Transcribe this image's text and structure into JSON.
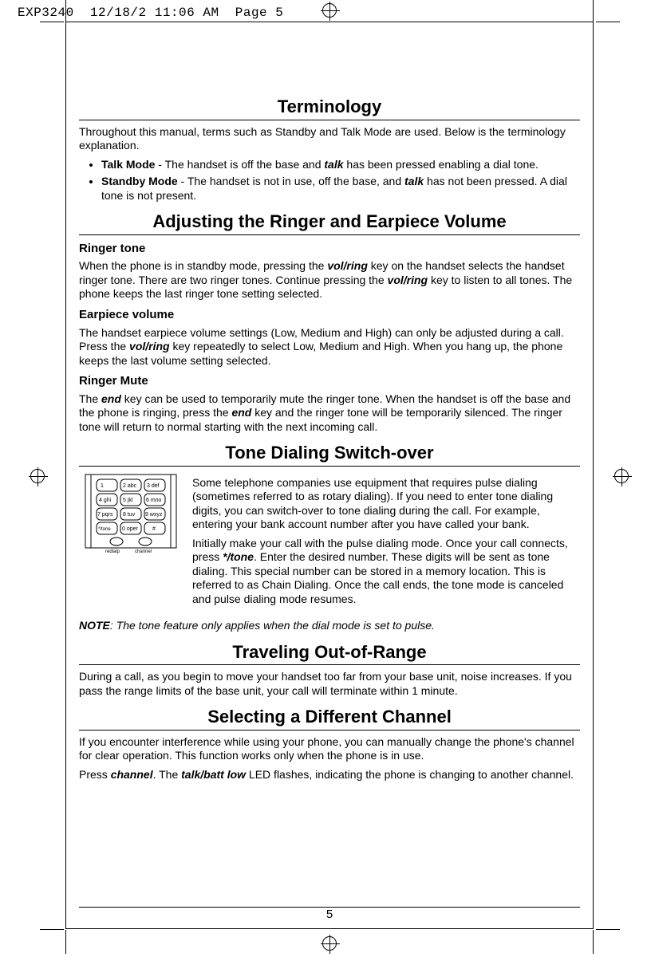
{
  "print_header": "EXP3240  12/18/2 11:06 AM  Page 5",
  "page_number": "5",
  "sec1": {
    "title": "Terminology",
    "intro": "Throughout this manual, terms such as Standby and Talk Mode are used. Below is the terminology explanation.",
    "items": [
      {
        "label": "Talk Mode",
        "text_pre": " - The handset is off the base and ",
        "key": "talk",
        "text_post": " has been pressed enabling a dial tone."
      },
      {
        "label": "Standby Mode",
        "text_pre": " - The handset is not in use, off the base, and ",
        "key": "talk",
        "text_post": " has not been pressed. A dial tone is not present."
      }
    ]
  },
  "sec2": {
    "title": "Adjusting the Ringer and Earpiece Volume",
    "ringer_tone_h": "Ringer tone",
    "ringer_tone_p1_a": "When the phone is in standby mode, pressing the ",
    "ringer_tone_key": "vol/ring",
    "ringer_tone_p1_b": " key on the handset selects the handset ringer tone. There are two ringer tones. Continue pressing the ",
    "ringer_tone_p1_c": " key to listen to all tones. The phone keeps the last ringer tone setting selected.",
    "earpiece_h": "Earpiece volume",
    "earpiece_p_a": "The handset earpiece volume settings (Low, Medium and High) can only be adjusted during a call. Press the ",
    "earpiece_p_b": " key repeatedly to select Low, Medium and High. When you hang up, the phone keeps the last volume setting selected.",
    "mute_h": "Ringer Mute",
    "mute_p_a": "The ",
    "mute_key": "end",
    "mute_p_b": " key can be used to temporarily mute the ringer tone. When the handset is off the base and the phone is ringing, press the ",
    "mute_p_c": " key and the ringer tone will be temporarily silenced. The ringer tone will return to normal starting with the next incoming call."
  },
  "sec3": {
    "title": "Tone Dialing Switch-over",
    "p1": "Some telephone companies use equipment that requires pulse dialing (sometimes referred to as rotary dialing). If you need to enter tone dialing digits, you can switch-over to tone dialing during the call. For example, entering your bank account number after you have called your bank.",
    "p2_a": "Initially make your call with the pulse dialing mode. Once your call connects, press ",
    "p2_key": "*/tone",
    "p2_b": ". Enter the desired number. These digits will be sent as tone dialing. This special number can be stored in a memory location. This is referred to as Chain Dialing. Once the call ends, the tone mode is canceled and pulse dialing mode resumes.",
    "note_label": "NOTE",
    "note_text": ": The tone feature only applies when the dial mode is set to pulse.",
    "keypad_labels": {
      "r1": [
        "1",
        "2 abc",
        "3 def"
      ],
      "r2": [
        "4 ghi",
        "5 jkl",
        "6 mno"
      ],
      "r3": [
        "7 pqrs",
        "8 tuv",
        "9 wxyz"
      ],
      "r4": [
        "*/tone",
        "0 oper",
        "#"
      ],
      "r5": [
        "redialp",
        "channel"
      ]
    }
  },
  "sec4": {
    "title": "Traveling Out-of-Range",
    "body": "During a call, as you begin to move your handset too far from your base unit, noise increases. If you pass the range limits of the base unit, your call will terminate within 1 minute."
  },
  "sec5": {
    "title": "Selecting a Different Channel",
    "p_a": "If you encounter interference while using your phone, you can manually change the phone's channel for clear operation. This function works only when the phone is in use.",
    "p_b_pre": "Press ",
    "p_b_key1": "channel",
    "p_b_mid": ". The ",
    "p_b_key2": "talk/batt low",
    "p_b_post": " LED flashes, indicating the phone is changing to another channel."
  }
}
